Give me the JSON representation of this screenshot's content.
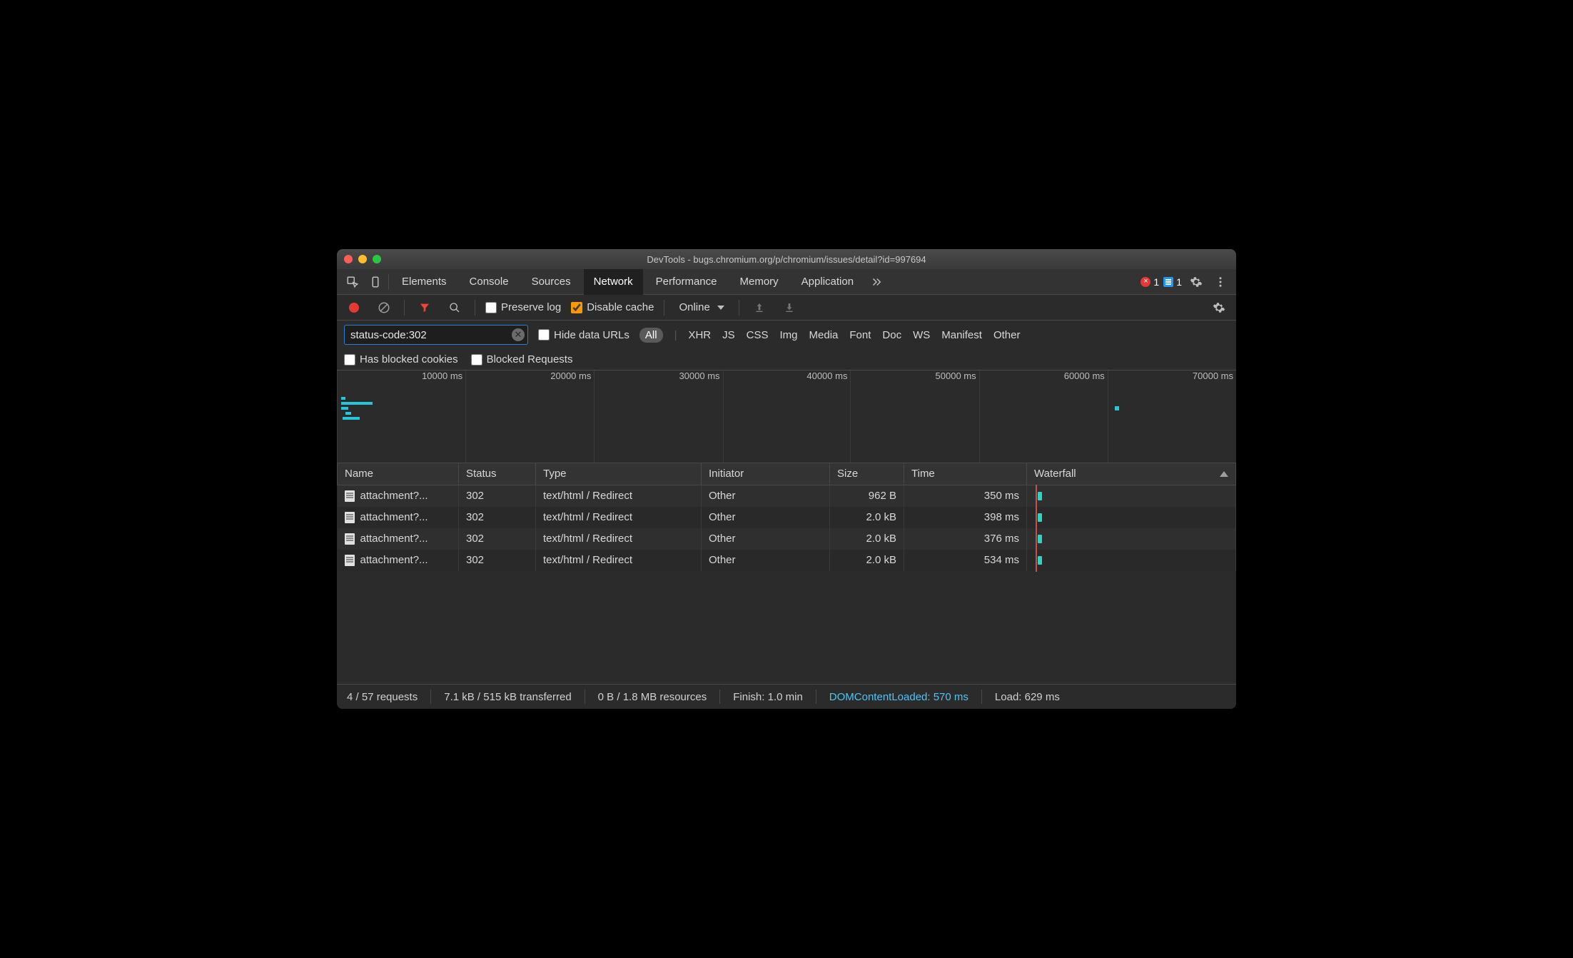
{
  "window": {
    "title": "DevTools - bugs.chromium.org/p/chromium/issues/detail?id=997694"
  },
  "tabs": {
    "items": [
      "Elements",
      "Console",
      "Sources",
      "Network",
      "Performance",
      "Memory",
      "Application"
    ],
    "active": "Network",
    "overflow_icon": "chevrons-right-icon",
    "errors_count": "1",
    "info_count": "1"
  },
  "toolbar": {
    "preserve_log_label": "Preserve log",
    "preserve_log_checked": false,
    "disable_cache_label": "Disable cache",
    "disable_cache_checked": true,
    "throttling_value": "Online"
  },
  "filter": {
    "value": "status-code:302",
    "hide_data_urls_label": "Hide data URLs",
    "hide_data_urls_checked": false,
    "types": [
      "All",
      "XHR",
      "JS",
      "CSS",
      "Img",
      "Media",
      "Font",
      "Doc",
      "WS",
      "Manifest",
      "Other"
    ],
    "types_active": "All",
    "has_blocked_cookies_label": "Has blocked cookies",
    "has_blocked_cookies_checked": false,
    "blocked_requests_label": "Blocked Requests",
    "blocked_requests_checked": false
  },
  "overview": {
    "ticks": [
      "10000 ms",
      "20000 ms",
      "30000 ms",
      "40000 ms",
      "50000 ms",
      "60000 ms",
      "70000 ms"
    ]
  },
  "table": {
    "columns": [
      "Name",
      "Status",
      "Type",
      "Initiator",
      "Size",
      "Time",
      "Waterfall"
    ],
    "sort_column": "Waterfall",
    "rows": [
      {
        "name": "attachment?...",
        "status": "302",
        "type": "text/html / Redirect",
        "initiator": "Other",
        "size": "962 B",
        "time": "350 ms"
      },
      {
        "name": "attachment?...",
        "status": "302",
        "type": "text/html / Redirect",
        "initiator": "Other",
        "size": "2.0 kB",
        "time": "398 ms"
      },
      {
        "name": "attachment?...",
        "status": "302",
        "type": "text/html / Redirect",
        "initiator": "Other",
        "size": "2.0 kB",
        "time": "376 ms"
      },
      {
        "name": "attachment?...",
        "status": "302",
        "type": "text/html / Redirect",
        "initiator": "Other",
        "size": "2.0 kB",
        "time": "534 ms"
      }
    ]
  },
  "status": {
    "requests": "4 / 57 requests",
    "transferred": "7.1 kB / 515 kB transferred",
    "resources": "0 B / 1.8 MB resources",
    "finish": "Finish: 1.0 min",
    "dcl": "DOMContentLoaded: 570 ms",
    "load": "Load: 629 ms"
  }
}
